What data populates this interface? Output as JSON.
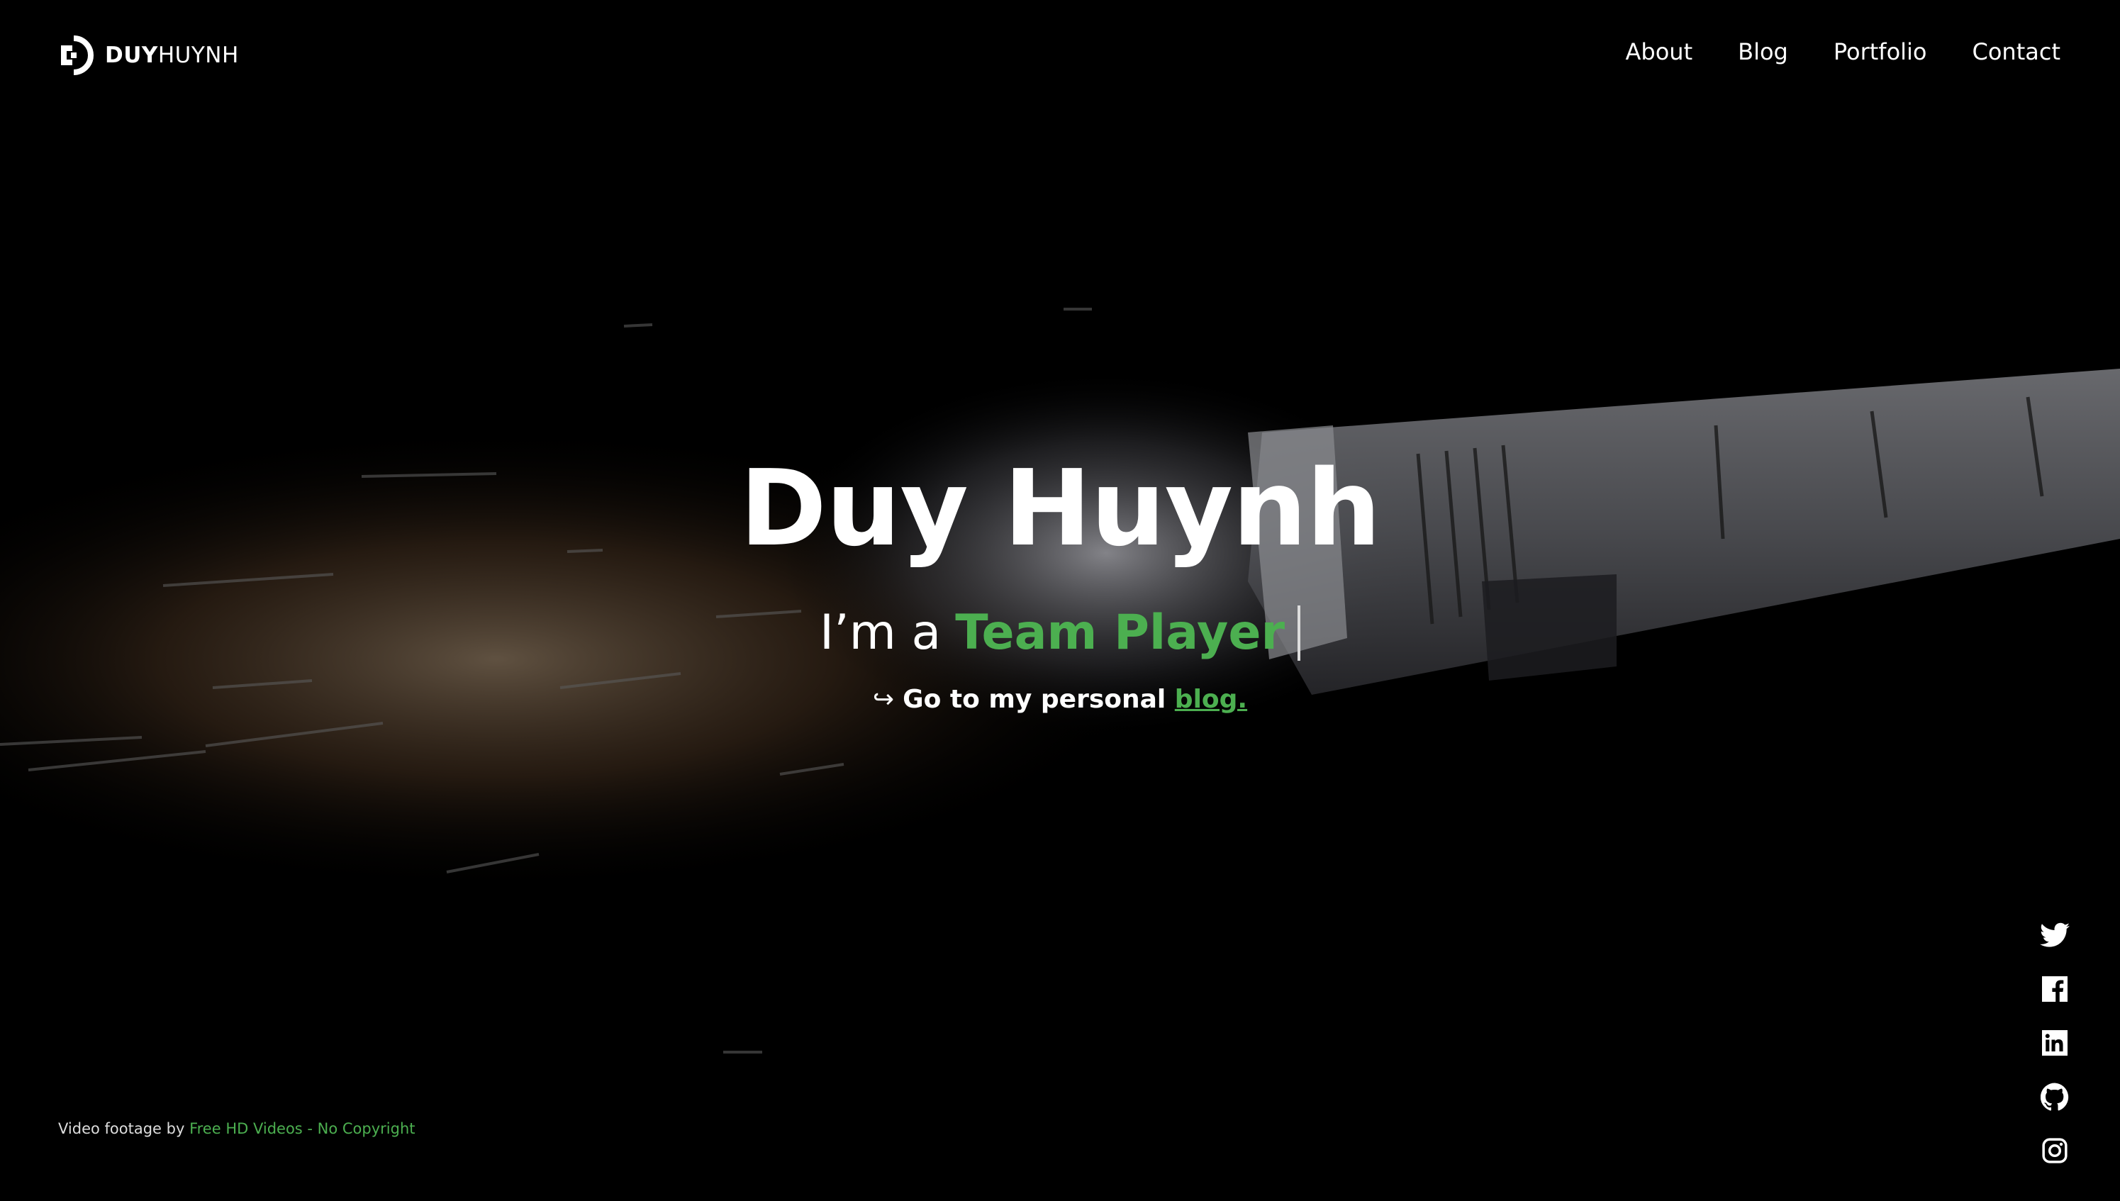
{
  "brand": {
    "logo_bold": "DUY",
    "logo_light": "HUYNH"
  },
  "nav": {
    "items": [
      "About",
      "Blog",
      "Portfolio",
      "Contact"
    ]
  },
  "hero": {
    "name": "Duy Huynh",
    "tagline_prefix": "I’m a",
    "tagline_role": "Team Player",
    "blog_prefix": "Go to my personal",
    "blog_link": "blog.",
    "arrow": "↪"
  },
  "footer": {
    "credit_prefix": "Video footage by",
    "credit_link": "Free HD Videos - No Copyright"
  },
  "social": [
    "twitter-icon",
    "facebook-icon",
    "linkedin-icon",
    "github-icon",
    "instagram-icon"
  ],
  "colors": {
    "accent": "#4caf50",
    "background": "#000000",
    "text": "#ffffff"
  }
}
